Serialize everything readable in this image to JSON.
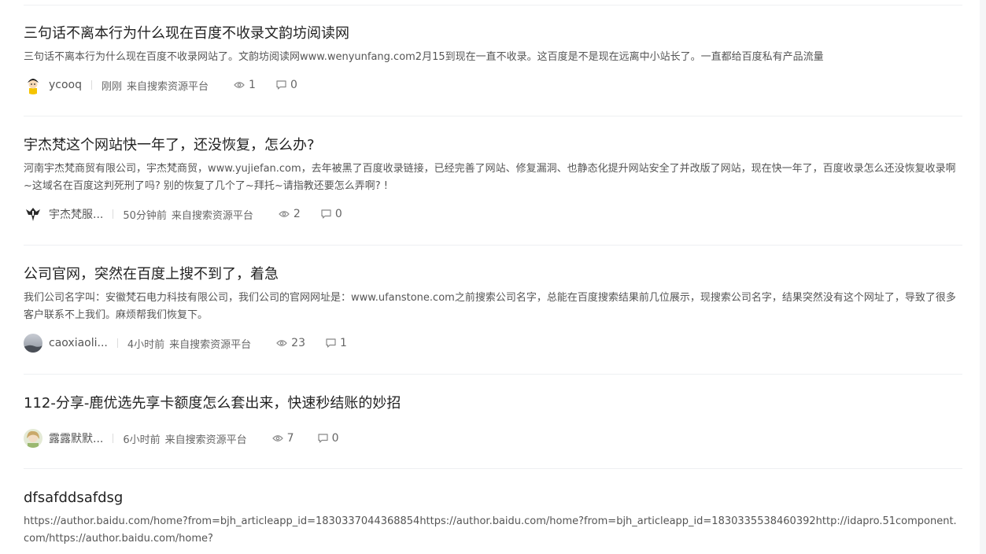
{
  "posts": [
    {
      "title": "三句话不离本行为什么现在百度不收录文韵坊阅读网",
      "summary": "三句话不离本行为什么现在百度不收录网站了。文韵坊阅读网www.wenyunfang.com2月15到现在一直不收录。这百度是不是现在远离中小站长了。一直都给百度私有产品流量",
      "user": "ycooq",
      "time": "刚刚",
      "source": "来自搜索资源平台",
      "views": "1",
      "comments": "0"
    },
    {
      "title": "宇杰梵这个网站快一年了，还没恢复，怎么办?",
      "summary": "河南宇杰梵商贸有限公司，宇杰梵商贸，www.yujiefan.com，去年被黑了百度收录链接，已经完善了网站、修复漏洞、也静态化提升网站安全了并改版了网站，现在快一年了，百度收录怎么还没恢复收录啊~这域名在百度这判死刑了吗? 别的恢复了几个了~拜托~请指教还要怎么弄啊? !",
      "user": "宇杰梵服...",
      "time": "50分钟前",
      "source": "来自搜索资源平台",
      "views": "2",
      "comments": "0"
    },
    {
      "title": "公司官网，突然在百度上搜不到了，着急",
      "summary": "我们公司名字叫：安徽梵石电力科技有限公司，我们公司的官网网址是：www.ufanstone.com之前搜索公司名字，总能在百度搜索结果前几位展示，现搜索公司名字，结果突然没有这个网址了，导致了很多客户联系不上我们。麻烦帮我们恢复下。",
      "user": "caoxiaoli...",
      "time": "4小时前",
      "source": "来自搜索资源平台",
      "views": "23",
      "comments": "1"
    },
    {
      "title": "112-分享-鹿优选先享卡额度怎么套出来，快速秒结账的妙招",
      "summary": "",
      "user": "露露默默...",
      "time": "6小时前",
      "source": "来自搜索资源平台",
      "views": "7",
      "comments": "0"
    },
    {
      "title": "dfsafddsafdsg",
      "summary": "https://author.baidu.com/home?from=bjh_articleapp_id=1830337044368854https://author.baidu.com/home?from=bjh_articleapp_id=1830335538460392http://idapro.51component.com/https://author.baidu.com/home?"
    }
  ],
  "icons": {
    "views": "eye-icon",
    "comments": "comment-icon"
  },
  "colors": {
    "title": "#222222",
    "summary": "#555555",
    "meta": "#666666",
    "divider": "#eef0f2"
  }
}
